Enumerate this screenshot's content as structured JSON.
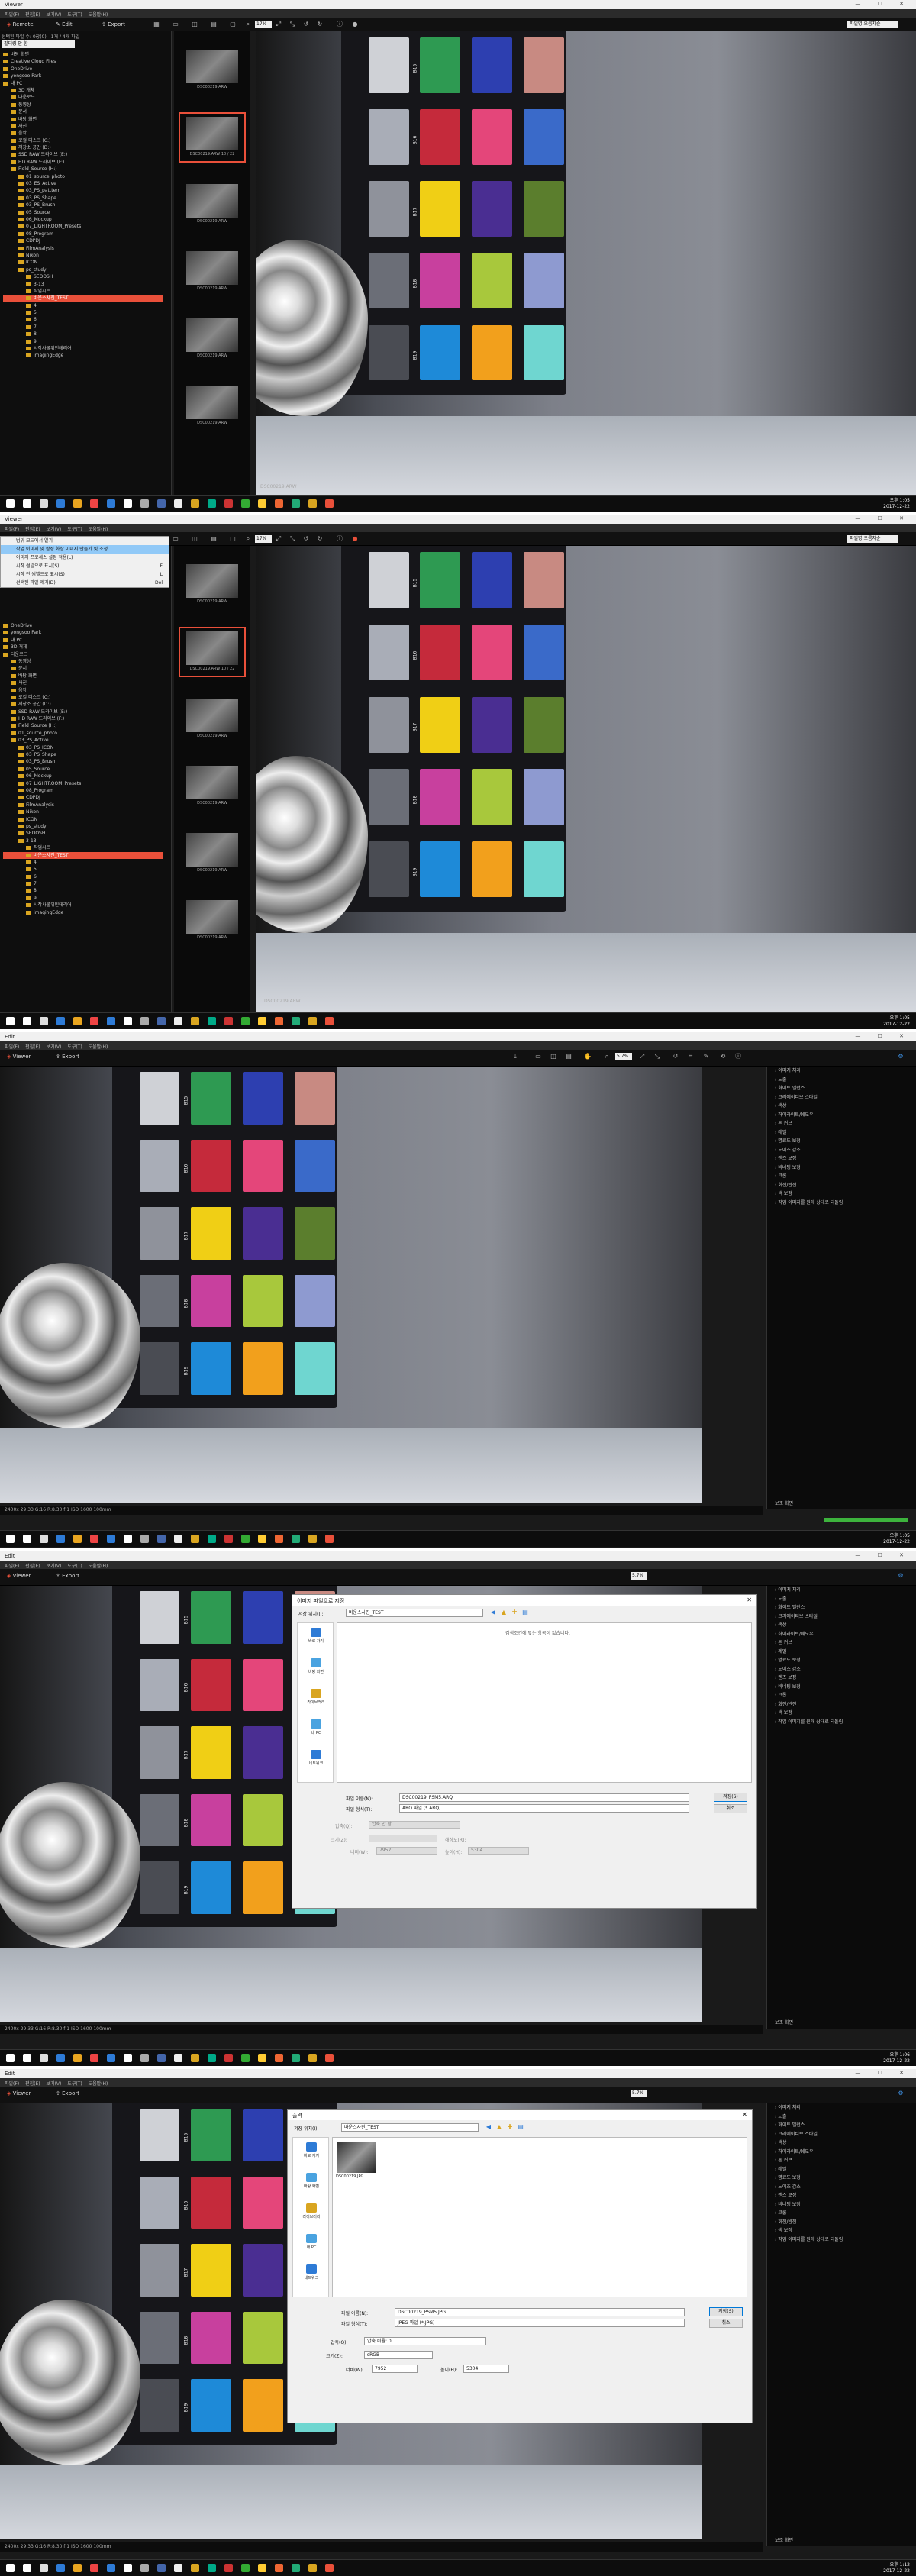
{
  "window": {
    "title": "Viewer",
    "title_edit": "Edit",
    "controls": "— ☐ ✕"
  },
  "menu": {
    "items": [
      "파일(F)",
      "편집(E)",
      "보기(V)",
      "도구(T)",
      "도움말(H)"
    ]
  },
  "toolbar": {
    "remote_label": "Remote",
    "edit_label": "Edit",
    "viewer_label": "Viewer",
    "export_label": "Export",
    "zoom_value": "17%",
    "zoom_value_edit": "5.7%",
    "dropdown_value": "파일명 오름차순"
  },
  "browser": {
    "address": "선택된 파일 수: 0장(0) - 1개 / 4개 파일",
    "filter_placeholder": "필터링 안 함",
    "tree": [
      "바탕 화면",
      "Creative Cloud Files",
      "OneDrive",
      "yongsoo Park",
      "내 PC",
      "3D 개체",
      "다운로드",
      "동영상",
      "문서",
      "바탕 화면",
      "사진",
      "음악",
      "로컬 디스크 (C:)",
      "저장소 공간 (D:)",
      "SSD RAW 드라이브 (E:)",
      "HD RAW 드라이브 (F:)",
      "Field_Source (H:)",
      "01_source_photo",
      "03_ES_Active",
      "03_PS_patttern",
      "03_PS_Shape",
      "03_PS_Brush",
      "05_Source",
      "06_Mockup",
      "07_LIGHTROOM_Presets",
      "08_Program",
      "CDPDJ",
      "FilmAnalysis",
      "Nikon",
      "ICON",
      "ps_study",
      "SEOOSH",
      "3-13",
      "작업시트",
      "바운스사진_TEST",
      "4",
      "5",
      "6",
      "7",
      "8",
      "9",
      "시작사물위인테리어",
      "imagingEdge"
    ],
    "tree2": [
      "OneDrive",
      "yongsoo Park",
      "내 PC",
      "3D 개체",
      "다운로드",
      "동영상",
      "문서",
      "바탕 화면",
      "사진",
      "음악",
      "로컬 디스크 (C:)",
      "저장소 공간 (D:)",
      "SSD RAW 드라이브 (E:)",
      "HD RAW 드라이브 (F:)",
      "Field_Source (H:)",
      "01_source_photo",
      "03_PS_Active",
      "03_PS_ICON",
      "03_PS_Shape",
      "03_PS_Brush",
      "05_Source",
      "06_Mockup",
      "07_LIGHTROOM_Presets",
      "08_Program",
      "CDPDJ",
      "FilmAnalysis",
      "Nikon",
      "ICON",
      "ps_study",
      "SEOOSH",
      "3-13",
      "작업시트",
      "바운스사진_TEST",
      "4",
      "5",
      "6",
      "7",
      "8",
      "9",
      "시작사물위인테리어",
      "imagingEdge"
    ]
  },
  "thumbs": [
    {
      "name": "DSC00219.ARW"
    },
    {
      "name": "DSC00219.ARW 10 / 22"
    },
    {
      "name": "DSC00219.ARW"
    },
    {
      "name": "DSC00219.ARW"
    },
    {
      "name": "DSC00219.ARW"
    },
    {
      "name": "DSC00219.ARW"
    }
  ],
  "photo": {
    "filename": "DSC00219.ARW",
    "patch_labels": [
      "B15",
      "B16",
      "B17",
      "B18",
      "B19",
      "B20",
      "B21",
      "B22",
      "B23",
      "B24",
      "B25"
    ]
  },
  "status": {
    "s1": "DSC00219.ARW",
    "s3": "2400x  29.33 G:16 R:8.30 f:1 ISO 1600 100mm",
    "s4": "2400x  29.33 G:16 R:8.30 f:1 ISO 1600 100mm",
    "s5": "2400x  29.33 G:16 R:8.30 f:1 ISO 1600 100mm"
  },
  "clock": {
    "s1": "오후 1:05\n2017-12-22",
    "s2": "오후 1:05\n2017-12-22",
    "s3": "오후 1:05\n2017-12-22",
    "s4": "오후 1:06\n2017-12-22",
    "s5": "오후 1:12\n2017-12-22"
  },
  "context_menu": {
    "items": [
      {
        "label": "범위 모드에서 열기"
      },
      {
        "label": "작업 이미지 및 활성 화상 이미지 만들기 및 조정",
        "highlight": true
      },
      {
        "label": "이미지 프로세스 설정 적용(L)"
      },
      {
        "label": "시작 썸넬으로 표시(S)",
        "key": "F"
      },
      {
        "label": "시작 전 썸넬으로 표시(S)",
        "key": "L"
      },
      {
        "label": "선택된 파일 제거(D)",
        "key": "Del"
      }
    ]
  },
  "adjust_panel": {
    "items": [
      "이미지 처리",
      "노출",
      "화이트 밸런스",
      "크리에이티브 스타일",
      "색상",
      "하이라이트/쉐도우",
      "톤 커브",
      "레벨",
      "명료도 보정",
      "노이즈 감소",
      "렌즈 보정",
      "비네팅 보정",
      "크롭",
      "회전/반전",
      "색 보정",
      "작업 이미지를 원래 상태로 되돌림"
    ],
    "footer": "보조 화면"
  },
  "save_dialog": {
    "title": "이미지 파일으로 저장",
    "look_in_label": "저장 위치(I):",
    "look_in_value": "바운스사진_TEST",
    "empty_text": "검색조건에 맞는 항목이 없습니다.",
    "places": [
      "바로 가기",
      "바탕 화면",
      "라이브러리",
      "내 PC",
      "네트워크"
    ],
    "filename_label": "파일 이름(N):",
    "filename_value": "DSC00219_PSM5.ARQ",
    "filetype_label": "파일 형식(T):",
    "filetype_value": "ARQ 파일 (*.ARQ)",
    "save_btn": "저장(S)",
    "cancel_btn": "취소",
    "quality_label": "압축(Q):",
    "quality_value": "압축 안 함",
    "size_label": "크기(Z):",
    "size_value": "",
    "long_label": "너비(W):",
    "long_value": "7952",
    "short_label": "높이(H):",
    "short_value": "5304",
    "dpi_label": "해상도(R):",
    "dpi_value": ""
  },
  "save_dialog2": {
    "title": "출력",
    "look_in_label": "저장 위치(I):",
    "look_in_value": "바운스사진_TEST",
    "file_item": "DSC00219.JPG",
    "places": [
      "바로 가기",
      "바탕 화면",
      "라이브러리",
      "내 PC",
      "네트워크"
    ],
    "filename_label": "파일 이름(N):",
    "filename_value": "DSC00219_PSM5.JPG",
    "filetype_label": "파일 형식(T):",
    "filetype_value": "JPEG 파일 (*.JPG)",
    "save_btn": "저장(S)",
    "cancel_btn": "취소",
    "quality_label": "압축(Q):",
    "quality_value": "압축 비율: 0",
    "size_label": "크기(Z):",
    "size_value": "sRGB",
    "long_label": "너비(W):",
    "long_value": "7952",
    "short_label": "높이(H):",
    "short_value": "5304"
  },
  "colors": {
    "accent": "#e9503a",
    "folder": "#d9a520"
  }
}
